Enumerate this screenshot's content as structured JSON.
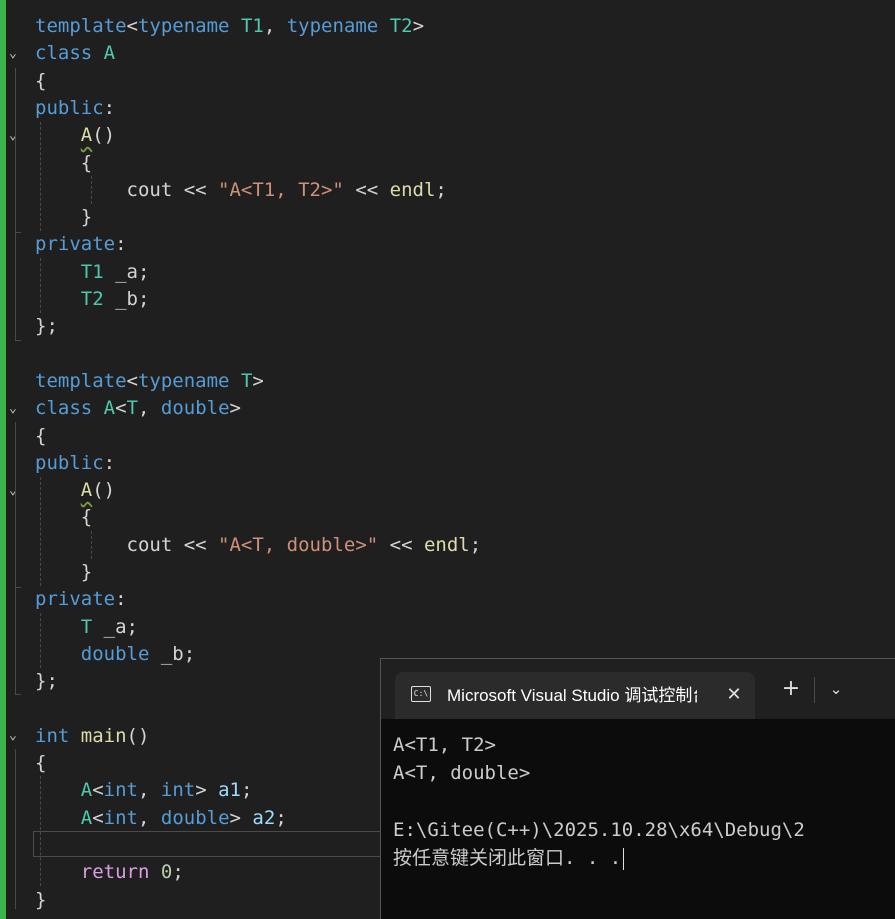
{
  "editor": {
    "lines": [
      {
        "t": [
          [
            "template",
            "kw"
          ],
          [
            "<",
            "pu"
          ],
          [
            "typename",
            "kw"
          ],
          [
            " ",
            "pu"
          ],
          [
            "T1",
            "ty"
          ],
          [
            ", ",
            "pu"
          ],
          [
            "typename",
            "kw"
          ],
          [
            " ",
            "pu"
          ],
          [
            "T2",
            "ty"
          ],
          [
            ">",
            "pu"
          ]
        ]
      },
      {
        "t": [
          [
            "class",
            "kw"
          ],
          [
            " ",
            "pu"
          ],
          [
            "A",
            "ty"
          ]
        ]
      },
      {
        "t": [
          [
            "{",
            "pu"
          ]
        ]
      },
      {
        "t": [
          [
            "public",
            "kw"
          ],
          [
            ":",
            "pu"
          ]
        ]
      },
      {
        "t": [
          [
            "    ",
            "pu"
          ],
          [
            "A",
            "fn squig"
          ],
          [
            "()",
            "pu"
          ]
        ]
      },
      {
        "t": [
          [
            "    ",
            "pu"
          ],
          [
            "{",
            "pu"
          ]
        ]
      },
      {
        "t": [
          [
            "        ",
            "pu"
          ],
          [
            "cout",
            "pu"
          ],
          [
            " << ",
            "pu"
          ],
          [
            "\"A<T1, T2>\"",
            "st"
          ],
          [
            " << ",
            "pu"
          ],
          [
            "endl",
            "fn"
          ],
          [
            ";",
            "pu"
          ]
        ]
      },
      {
        "t": [
          [
            "    ",
            "pu"
          ],
          [
            "}",
            "pu"
          ]
        ]
      },
      {
        "t": [
          [
            "private",
            "kw"
          ],
          [
            ":",
            "pu"
          ]
        ]
      },
      {
        "t": [
          [
            "    ",
            "pu"
          ],
          [
            "T1",
            "ty"
          ],
          [
            " _a;",
            "pu"
          ]
        ]
      },
      {
        "t": [
          [
            "    ",
            "pu"
          ],
          [
            "T2",
            "ty"
          ],
          [
            " _b;",
            "pu"
          ]
        ]
      },
      {
        "t": [
          [
            "};",
            "pu"
          ]
        ]
      },
      {
        "t": []
      },
      {
        "t": [
          [
            "template",
            "kw"
          ],
          [
            "<",
            "pu"
          ],
          [
            "typename",
            "kw"
          ],
          [
            " ",
            "pu"
          ],
          [
            "T",
            "ty"
          ],
          [
            ">",
            "pu"
          ]
        ]
      },
      {
        "t": [
          [
            "class",
            "kw"
          ],
          [
            " ",
            "pu"
          ],
          [
            "A",
            "ty"
          ],
          [
            "<",
            "pu"
          ],
          [
            "T",
            "ty"
          ],
          [
            ", ",
            "pu"
          ],
          [
            "double",
            "kw"
          ],
          [
            ">",
            "pu"
          ]
        ]
      },
      {
        "t": [
          [
            "{",
            "pu"
          ]
        ]
      },
      {
        "t": [
          [
            "public",
            "kw"
          ],
          [
            ":",
            "pu"
          ]
        ]
      },
      {
        "t": [
          [
            "    ",
            "pu"
          ],
          [
            "A",
            "fn squig"
          ],
          [
            "()",
            "pu"
          ]
        ]
      },
      {
        "t": [
          [
            "    ",
            "pu"
          ],
          [
            "{",
            "pu"
          ]
        ]
      },
      {
        "t": [
          [
            "        ",
            "pu"
          ],
          [
            "cout",
            "pu"
          ],
          [
            " << ",
            "pu"
          ],
          [
            "\"A<T, double>\"",
            "st"
          ],
          [
            " << ",
            "pu"
          ],
          [
            "endl",
            "fn"
          ],
          [
            ";",
            "pu"
          ]
        ]
      },
      {
        "t": [
          [
            "    ",
            "pu"
          ],
          [
            "}",
            "pu"
          ]
        ]
      },
      {
        "t": [
          [
            "private",
            "kw"
          ],
          [
            ":",
            "pu"
          ]
        ]
      },
      {
        "t": [
          [
            "    ",
            "pu"
          ],
          [
            "T",
            "ty"
          ],
          [
            " _a;",
            "pu"
          ]
        ]
      },
      {
        "t": [
          [
            "    ",
            "pu"
          ],
          [
            "double",
            "kw"
          ],
          [
            " _b;",
            "pu"
          ]
        ]
      },
      {
        "t": [
          [
            "};",
            "pu"
          ]
        ]
      },
      {
        "t": []
      },
      {
        "t": [
          [
            "int",
            "kw"
          ],
          [
            " ",
            "pu"
          ],
          [
            "main",
            "fn"
          ],
          [
            "()",
            "pu"
          ]
        ]
      },
      {
        "t": [
          [
            "{",
            "pu"
          ]
        ]
      },
      {
        "t": [
          [
            "    ",
            "pu"
          ],
          [
            "A",
            "ty"
          ],
          [
            "<",
            "pu"
          ],
          [
            "int",
            "kw"
          ],
          [
            ", ",
            "pu"
          ],
          [
            "int",
            "kw"
          ],
          [
            "> ",
            "pu"
          ],
          [
            "a1",
            "va"
          ],
          [
            ";",
            "pu"
          ]
        ]
      },
      {
        "t": [
          [
            "    ",
            "pu"
          ],
          [
            "A",
            "ty"
          ],
          [
            "<",
            "pu"
          ],
          [
            "int",
            "kw"
          ],
          [
            ", ",
            "pu"
          ],
          [
            "double",
            "kw"
          ],
          [
            "> ",
            "pu"
          ],
          [
            "a2",
            "va"
          ],
          [
            ";",
            "pu"
          ]
        ]
      },
      {
        "t": []
      },
      {
        "t": [
          [
            "    ",
            "pu"
          ],
          [
            "return",
            "cf"
          ],
          [
            " ",
            "pu"
          ],
          [
            "0",
            "nu"
          ],
          [
            ";",
            "pu"
          ]
        ]
      },
      {
        "t": [
          [
            "}",
            "pu"
          ]
        ]
      }
    ]
  },
  "console": {
    "tab_title": "Microsoft Visual Studio 调试控制台",
    "tab_icon": "C:\\",
    "close_icon": "✕",
    "new_tab_icon": "+",
    "dropdown_icon": "⌄",
    "output": [
      "A<T1, T2>",
      "A<T, double>",
      "",
      "E:\\Gitee(C++)\\2025.10.28\\x64\\Debug\\2",
      "按任意键关闭此窗口. . ."
    ]
  }
}
